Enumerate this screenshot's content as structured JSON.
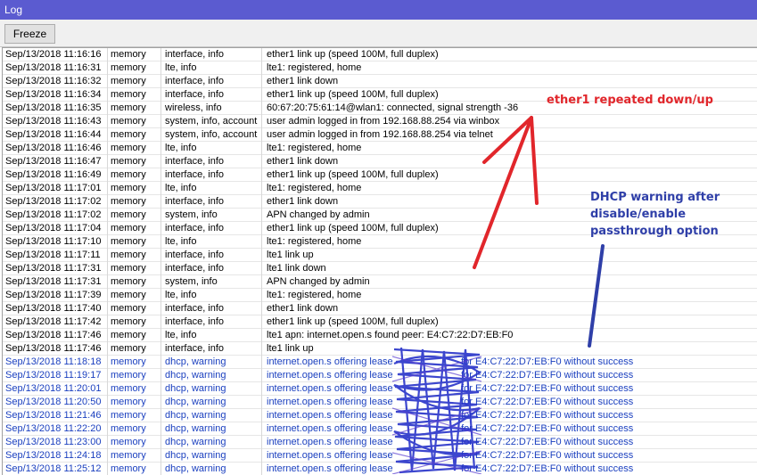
{
  "window": {
    "title": "Log"
  },
  "toolbar": {
    "freeze_label": "Freeze"
  },
  "log": [
    {
      "time": "Sep/13/2018 11:16:16",
      "buffer": "memory",
      "topics": "interface, info",
      "message": "ether1 link up (speed 100M, full duplex)"
    },
    {
      "time": "Sep/13/2018 11:16:31",
      "buffer": "memory",
      "topics": "lte, info",
      "message": "lte1: registered, home"
    },
    {
      "time": "Sep/13/2018 11:16:32",
      "buffer": "memory",
      "topics": "interface, info",
      "message": "ether1 link down"
    },
    {
      "time": "Sep/13/2018 11:16:34",
      "buffer": "memory",
      "topics": "interface, info",
      "message": "ether1 link up (speed 100M, full duplex)"
    },
    {
      "time": "Sep/13/2018 11:16:35",
      "buffer": "memory",
      "topics": "wireless, info",
      "message": "60:67:20:75:61:14@wlan1: connected, signal strength -36"
    },
    {
      "time": "Sep/13/2018 11:16:43",
      "buffer": "memory",
      "topics": "system, info, account",
      "message": "user admin logged in from 192.168.88.254 via winbox"
    },
    {
      "time": "Sep/13/2018 11:16:44",
      "buffer": "memory",
      "topics": "system, info, account",
      "message": "user admin logged in from 192.168.88.254 via telnet"
    },
    {
      "time": "Sep/13/2018 11:16:46",
      "buffer": "memory",
      "topics": "lte, info",
      "message": "lte1: registered, home"
    },
    {
      "time": "Sep/13/2018 11:16:47",
      "buffer": "memory",
      "topics": "interface, info",
      "message": "ether1 link down"
    },
    {
      "time": "Sep/13/2018 11:16:49",
      "buffer": "memory",
      "topics": "interface, info",
      "message": "ether1 link up (speed 100M, full duplex)"
    },
    {
      "time": "Sep/13/2018 11:17:01",
      "buffer": "memory",
      "topics": "lte, info",
      "message": "lte1: registered, home"
    },
    {
      "time": "Sep/13/2018 11:17:02",
      "buffer": "memory",
      "topics": "interface, info",
      "message": "ether1 link down"
    },
    {
      "time": "Sep/13/2018 11:17:02",
      "buffer": "memory",
      "topics": "system, info",
      "message": "APN changed by admin"
    },
    {
      "time": "Sep/13/2018 11:17:04",
      "buffer": "memory",
      "topics": "interface, info",
      "message": "ether1 link up (speed 100M, full duplex)"
    },
    {
      "time": "Sep/13/2018 11:17:10",
      "buffer": "memory",
      "topics": "lte, info",
      "message": "lte1: registered, home"
    },
    {
      "time": "Sep/13/2018 11:17:11",
      "buffer": "memory",
      "topics": "interface, info",
      "message": "lte1 link up"
    },
    {
      "time": "Sep/13/2018 11:17:31",
      "buffer": "memory",
      "topics": "interface, info",
      "message": "lte1 link down"
    },
    {
      "time": "Sep/13/2018 11:17:31",
      "buffer": "memory",
      "topics": "system, info",
      "message": "APN changed by admin"
    },
    {
      "time": "Sep/13/2018 11:17:39",
      "buffer": "memory",
      "topics": "lte, info",
      "message": "lte1: registered, home"
    },
    {
      "time": "Sep/13/2018 11:17:40",
      "buffer": "memory",
      "topics": "interface, info",
      "message": "ether1 link down"
    },
    {
      "time": "Sep/13/2018 11:17:42",
      "buffer": "memory",
      "topics": "interface, info",
      "message": "ether1 link up (speed 100M, full duplex)"
    },
    {
      "time": "Sep/13/2018 11:17:46",
      "buffer": "memory",
      "topics": "lte, info",
      "message": "lte1 apn: internet.open.s found peer: E4:C7:22:D7:EB:F0"
    },
    {
      "time": "Sep/13/2018 11:17:46",
      "buffer": "memory",
      "topics": "interface, info",
      "message": "lte1 link up"
    },
    {
      "time": "Sep/13/2018 11:18:18",
      "buffer": "memory",
      "topics": "dhcp, warning",
      "message": "internet.open.s offering lease                         for E4:C7:22:D7:EB:F0 without success"
    },
    {
      "time": "Sep/13/2018 11:19:17",
      "buffer": "memory",
      "topics": "dhcp, warning",
      "message": "internet.open.s offering lease                         for E4:C7:22:D7:EB:F0 without success"
    },
    {
      "time": "Sep/13/2018 11:20:01",
      "buffer": "memory",
      "topics": "dhcp, warning",
      "message": "internet.open.s offering lease                         for E4:C7:22:D7:EB:F0 without success"
    },
    {
      "time": "Sep/13/2018 11:20:50",
      "buffer": "memory",
      "topics": "dhcp, warning",
      "message": "internet.open.s offering lease                         for E4:C7:22:D7:EB:F0 without success"
    },
    {
      "time": "Sep/13/2018 11:21:46",
      "buffer": "memory",
      "topics": "dhcp, warning",
      "message": "internet.open.s offering lease                         for E4:C7:22:D7:EB:F0 without success"
    },
    {
      "time": "Sep/13/2018 11:22:20",
      "buffer": "memory",
      "topics": "dhcp, warning",
      "message": "internet.open.s offering lease                         for E4:C7:22:D7:EB:F0 without success"
    },
    {
      "time": "Sep/13/2018 11:23:00",
      "buffer": "memory",
      "topics": "dhcp, warning",
      "message": "internet.open.s offering lease                         for E4:C7:22:D7:EB:F0 without success"
    },
    {
      "time": "Sep/13/2018 11:24:18",
      "buffer": "memory",
      "topics": "dhcp, warning",
      "message": "internet.open.s offering lease                         for E4:C7:22:D7:EB:F0 without success"
    },
    {
      "time": "Sep/13/2018 11:25:12",
      "buffer": "memory",
      "topics": "dhcp, warning",
      "message": "internet.open.s offering lease                         for E4:C7:22:D7:EB:F0 without success"
    }
  ],
  "annotations": {
    "red_note": "ether1 repeated down/up",
    "blue_note_lines": [
      "DHCP warning after",
      "disable/enable",
      "passthrough option"
    ]
  },
  "colors": {
    "titlebar": "#5b5bd0",
    "warning_text": "#1a3fbf",
    "annotation_red": "#e1262b",
    "annotation_blue": "#2f3fa8"
  }
}
